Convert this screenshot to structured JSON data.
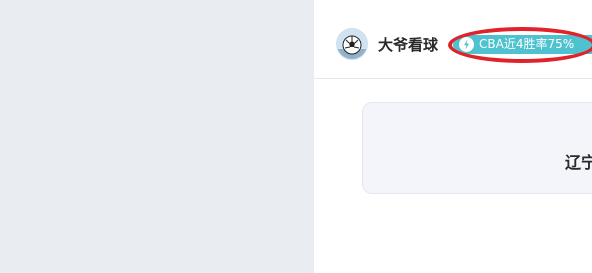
{
  "article": {
    "title": "",
    "author": {
      "name": "大爷看球",
      "avatar_icon": "soccer-ball-avatar"
    },
    "badge": {
      "icon": "lightning-icon",
      "text": "CBA近4胜率75%",
      "color": "#4fc2cf"
    },
    "highlight_color": "#e0222a"
  },
  "match_card": {
    "team_label": "辽宁"
  },
  "body": {
    "text": ""
  }
}
